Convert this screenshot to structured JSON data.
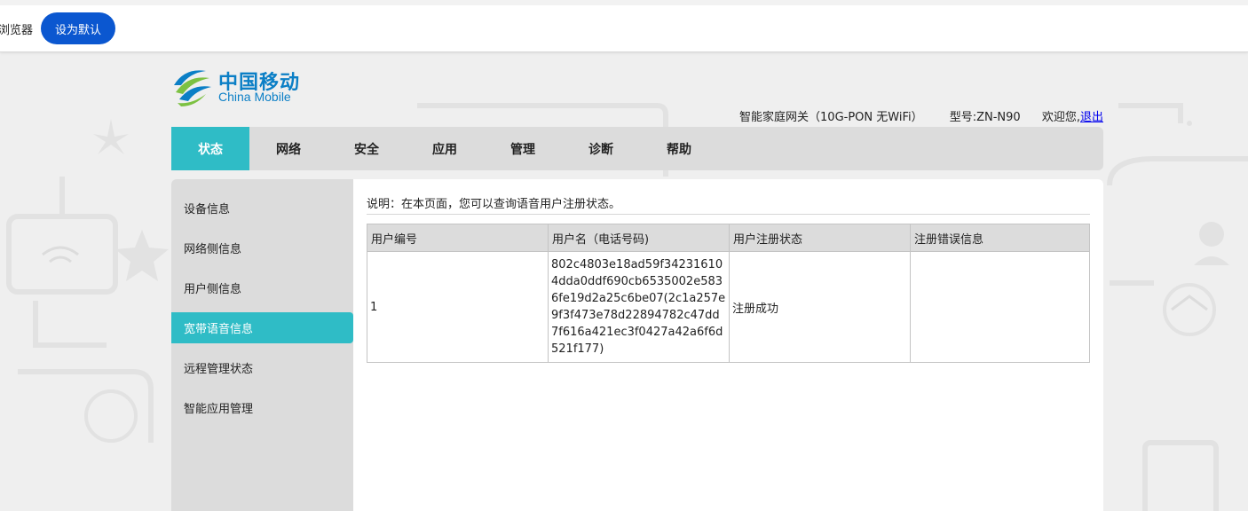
{
  "browser_bar": {
    "text": "浏览器",
    "set_default_label": "设为默认"
  },
  "logo": {
    "cn": "中国移动",
    "en": "China Mobile"
  },
  "header": {
    "device": "智能家庭网关（10G-PON 无WiFi）",
    "model": "型号:ZN-N90",
    "welcome": "欢迎您,",
    "logout": "退出"
  },
  "nav": {
    "items": [
      {
        "label": "状态",
        "active": true
      },
      {
        "label": "网络"
      },
      {
        "label": "安全"
      },
      {
        "label": "应用"
      },
      {
        "label": "管理"
      },
      {
        "label": "诊断"
      },
      {
        "label": "帮助"
      }
    ]
  },
  "sidebar": {
    "items": [
      {
        "label": "设备信息"
      },
      {
        "label": "网络侧信息"
      },
      {
        "label": "用户侧信息"
      },
      {
        "label": "宽带语音信息",
        "active": true
      },
      {
        "label": "远程管理状态"
      },
      {
        "label": "智能应用管理"
      }
    ]
  },
  "content": {
    "description": "说明：在本页面，您可以查询语音用户注册状态。",
    "table": {
      "headers": [
        "用户编号",
        "用户名（电话号码)",
        "用户注册状态",
        "注册错误信息"
      ],
      "rows": [
        {
          "id": "1",
          "username": "802c4803e18ad59f342316104dda0ddf690cb6535002e5836fe19d2a25c6be07(2c1a257e9f3f473e78d22894782c47dd7f616a421ec3f0427a42a6f6d521f177)",
          "status": "注册成功",
          "error": ""
        }
      ]
    }
  },
  "colors": {
    "accent": "#2fbcc6",
    "button_blue": "#0b57d0",
    "logo_blue": "#0b7fc6",
    "nav_bg": "#dcdcdc"
  }
}
